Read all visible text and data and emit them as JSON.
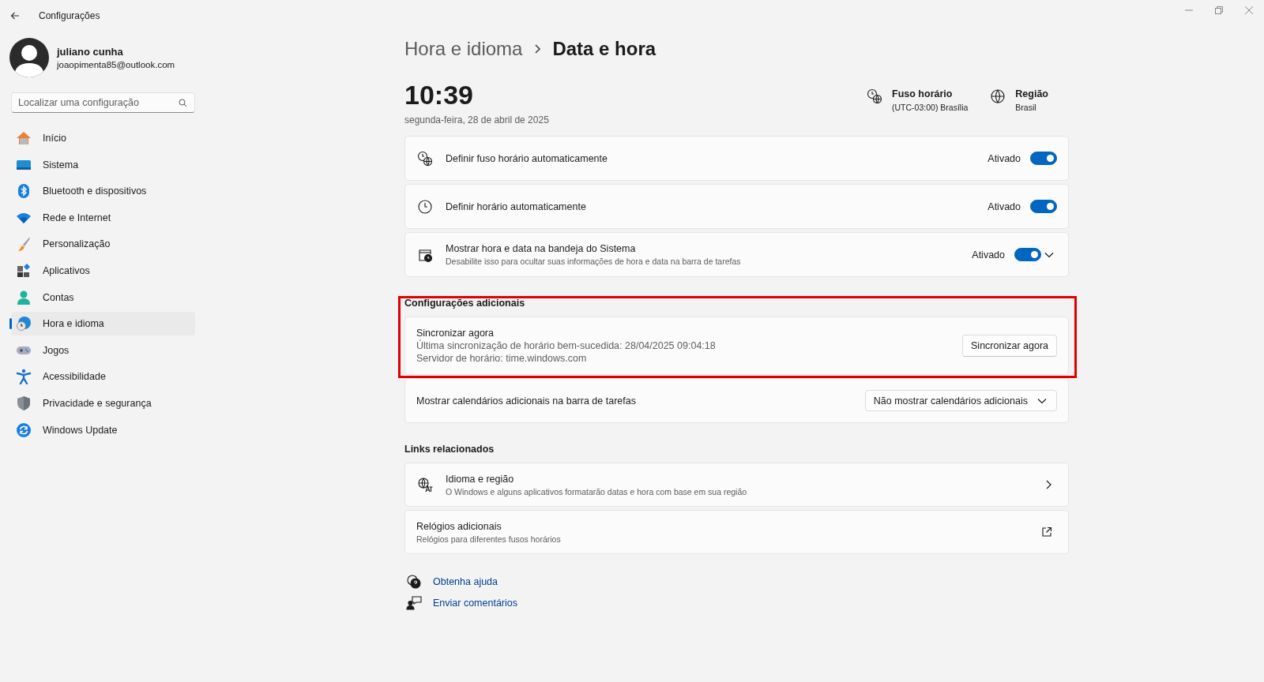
{
  "window": {
    "title": "Configurações"
  },
  "profile": {
    "name": "juliano cunha",
    "email": "joaopimenta85@outlook.com"
  },
  "search": {
    "placeholder": "Localizar uma configuração"
  },
  "nav": [
    {
      "kind": "home",
      "label": "Início",
      "selected": false
    },
    {
      "kind": "system",
      "label": "Sistema",
      "selected": false
    },
    {
      "kind": "bluetooth",
      "label": "Bluetooth e dispositivos",
      "selected": false
    },
    {
      "kind": "wifi",
      "label": "Rede e Internet",
      "selected": false
    },
    {
      "kind": "brush",
      "label": "Personalização",
      "selected": false
    },
    {
      "kind": "apps",
      "label": "Aplicativos",
      "selected": false
    },
    {
      "kind": "person",
      "label": "Contas",
      "selected": false
    },
    {
      "kind": "time",
      "label": "Hora e idioma",
      "selected": true
    },
    {
      "kind": "gamepad",
      "label": "Jogos",
      "selected": false
    },
    {
      "kind": "accessibility",
      "label": "Acessibilidade",
      "selected": false
    },
    {
      "kind": "shield",
      "label": "Privacidade e segurança",
      "selected": false
    },
    {
      "kind": "update",
      "label": "Windows Update",
      "selected": false
    }
  ],
  "breadcrumb": {
    "parent": "Hora e idioma",
    "current": "Data e hora"
  },
  "clock": {
    "time": "10:39",
    "date": "segunda-feira, 28 de abril de 2025"
  },
  "summary": [
    {
      "kind": "timezone",
      "title": "Fuso horário",
      "value": "(UTC-03:00) Brasília"
    },
    {
      "kind": "globe",
      "title": "Região",
      "value": "Brasil"
    }
  ],
  "toggles": [
    {
      "kind": "timezone",
      "label": "Definir fuso horário automaticamente",
      "state": "Ativado",
      "on": true,
      "expandable": false
    },
    {
      "kind": "clock",
      "label": "Definir horário automaticamente",
      "state": "Ativado",
      "on": true,
      "expandable": false
    },
    {
      "kind": "calendar-clock",
      "label": "Mostrar hora e data na bandeja do Sistema",
      "description": "Desabilite isso para ocultar suas informações de hora e data na barra de tarefas",
      "state": "Ativado",
      "on": true,
      "expandable": true
    }
  ],
  "additional": {
    "title": "Configurações adicionais",
    "highlighted": true,
    "sync": {
      "title": "Sincronizar agora",
      "last_sync": "Última sincronização de horário bem-sucedida: 28/04/2025 09:04:18",
      "server": "Servidor de horário: time.windows.com",
      "button": "Sincronizar agora"
    },
    "calendar": {
      "label": "Mostrar calendários adicionais na barra de tarefas",
      "value": "Não mostrar calendários adicionais"
    }
  },
  "related": {
    "title": "Links relacionados",
    "links": [
      {
        "kind": "language",
        "title": "Idioma e região",
        "description": "O Windows e alguns aplicativos formatarão datas e hora com base em sua região"
      },
      {
        "kind": "external",
        "title": "Relógios adicionais",
        "description": "Relógios para diferentes fusos horários"
      }
    ]
  },
  "help_links": [
    {
      "kind": "help",
      "label": "Obtenha ajuda"
    },
    {
      "kind": "feedback",
      "label": "Enviar comentários"
    }
  ]
}
